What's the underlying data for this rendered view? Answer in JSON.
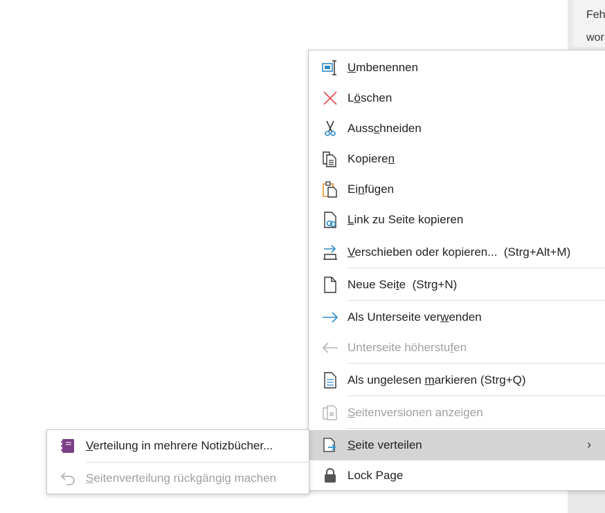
{
  "background": {
    "line1": "Feh",
    "line2": "wor"
  },
  "menu": {
    "items": [
      {
        "id": "rename",
        "pre": "",
        "u": "U",
        "post": "mbenennen",
        "shortcut": "",
        "icon": "rename-icon",
        "disabled": false
      },
      {
        "id": "delete",
        "pre": "L",
        "u": "ö",
        "post": "schen",
        "shortcut": "",
        "icon": "delete-icon",
        "disabled": false
      },
      {
        "id": "cut",
        "pre": "Auss",
        "u": "c",
        "post": "hneiden",
        "shortcut": "",
        "icon": "scissors-icon",
        "disabled": false
      },
      {
        "id": "copy",
        "pre": "Kopiere",
        "u": "n",
        "post": "",
        "shortcut": "",
        "icon": "copy-icon",
        "disabled": false
      },
      {
        "id": "paste",
        "pre": "Ei",
        "u": "n",
        "post": "fügen",
        "shortcut": "",
        "icon": "paste-icon",
        "disabled": false
      },
      {
        "id": "copy-link",
        "pre": "",
        "u": "L",
        "post": "ink zu Seite kopieren",
        "shortcut": "",
        "icon": "link-page-icon",
        "disabled": false
      },
      {
        "id": "move-copy",
        "pre": "",
        "u": "V",
        "post": "erschieben oder kopieren...",
        "shortcut": "(Strg+Alt+M)",
        "icon": "move-icon",
        "disabled": false
      },
      {
        "id": "new-page",
        "pre": "Neue Sei",
        "u": "t",
        "post": "e",
        "shortcut": "(Strg+N)",
        "icon": "new-page-icon",
        "disabled": false
      },
      {
        "id": "make-subpage",
        "pre": "Als Unterseite ver",
        "u": "w",
        "post": "enden",
        "shortcut": "",
        "icon": "arrow-right-icon",
        "disabled": false
      },
      {
        "id": "promote-subpage",
        "pre": "Unterseite höherstu",
        "u": "f",
        "post": "en",
        "shortcut": "",
        "icon": "arrow-left-icon",
        "disabled": true
      },
      {
        "id": "mark-unread",
        "pre": "Als ungelesen ",
        "u": "m",
        "post": "arkieren",
        "shortcut": "(Strg+Q)",
        "icon": "unread-page-icon",
        "disabled": false
      },
      {
        "id": "page-versions",
        "pre": "",
        "u": "S",
        "post": "eitenversionen anzeigen",
        "shortcut": "",
        "icon": "page-versions-icon",
        "disabled": true
      },
      {
        "id": "distribute-page",
        "pre": "",
        "u": "S",
        "post": "eite verteilen",
        "shortcut": "",
        "icon": "distribute-icon",
        "disabled": false
      },
      {
        "id": "lock-page",
        "pre": "Lock Page",
        "u": "",
        "post": "",
        "shortcut": "",
        "icon": "lock-icon",
        "disabled": false
      }
    ],
    "submenu_chevron": "›"
  },
  "submenu": {
    "items": [
      {
        "id": "distribute-notebooks",
        "pre": "",
        "u": "V",
        "post": "erteilung in mehrere Notizbücher...",
        "icon": "notebook-icon",
        "disabled": false
      },
      {
        "id": "undo-distribution",
        "pre": "",
        "u": "S",
        "post": "eitenverteilung rückgängig machen",
        "icon": "undo-icon",
        "disabled": true
      }
    ]
  },
  "colors": {
    "accent_blue": "#2e8bc8",
    "delete_red": "#d9534f",
    "paste_orange": "#e8912d",
    "notebook_purple": "#7b3f87",
    "disabled_gray": "#a0a0a0",
    "highlight": "#d4d4d4"
  }
}
